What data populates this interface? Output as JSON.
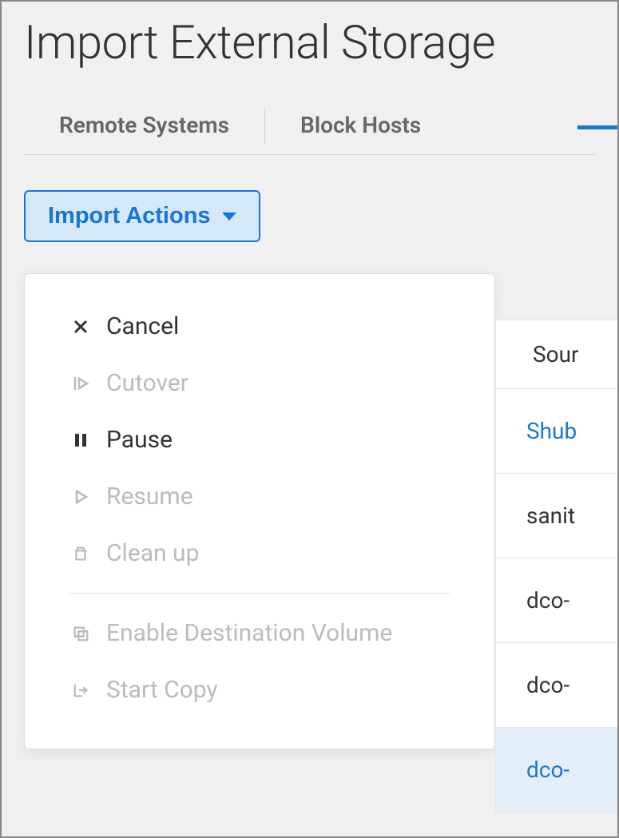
{
  "page_title": "Import External Storage",
  "tabs": {
    "remote_systems": "Remote Systems",
    "block_hosts": "Block Hosts"
  },
  "import_actions": {
    "button_label": "Import Actions",
    "items": {
      "cancel": "Cancel",
      "cutover": "Cutover",
      "pause": "Pause",
      "resume": "Resume",
      "clean_up": "Clean up",
      "enable_dest": "Enable Destination Volume",
      "start_copy": "Start Copy"
    }
  },
  "table": {
    "header": "Sour",
    "rows": [
      "Shub",
      "sanit",
      "dco-",
      "dco-",
      "dco-"
    ]
  },
  "colors": {
    "primary": "#1976d2",
    "disabled": "#bbb"
  }
}
